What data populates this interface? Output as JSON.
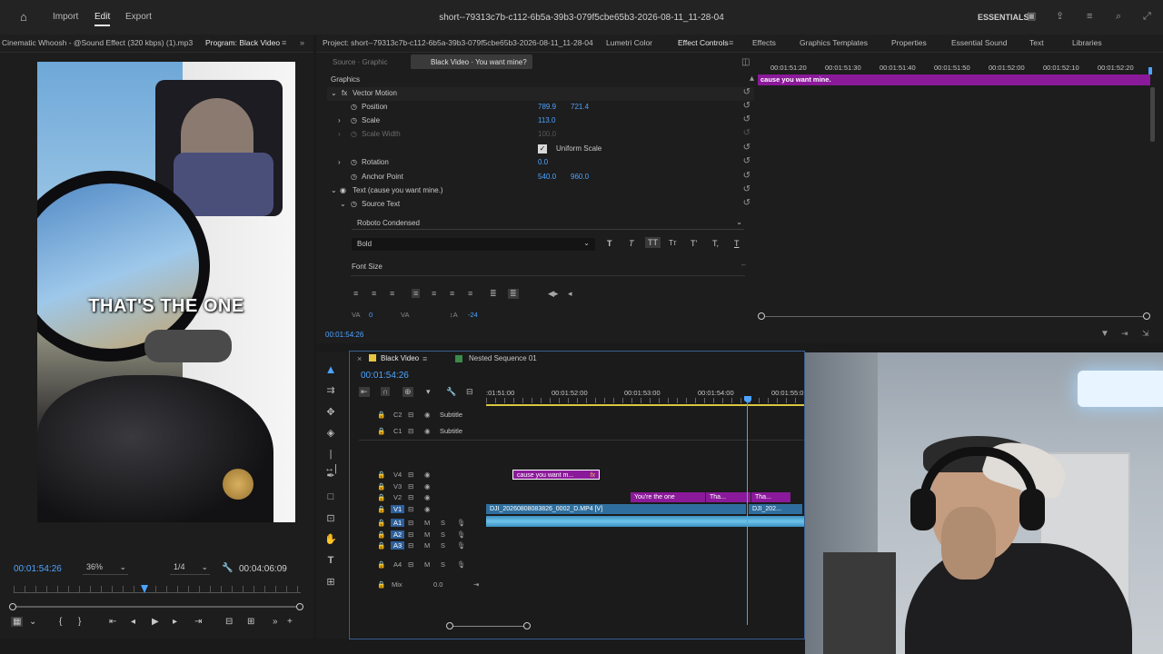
{
  "menu": {
    "import": "Import",
    "edit": "Edit",
    "export": "Export"
  },
  "project_title": "short--79313c7b-c112-6b5a-39b3-079f5cbe65b3-2026-08-11_11-28-04",
  "workspace": "ESSENTIALS",
  "panels": {
    "source_tab": "Cinematic Whoosh - @Sound Effect (320 kbps) (1).mp3",
    "program_tab": "Program: Black Video",
    "project_tab": "Project: short--79313c7b-c112-6b5a-39b3-079f5cbe65b3-2026-08-11_11-28-04",
    "lumetri": "Lumetri Color",
    "effect_controls": "Effect Controls",
    "effects": "Effects",
    "graphics_templates": "Graphics Templates",
    "properties": "Properties",
    "essential_sound": "Essential Sound",
    "text": "Text",
    "libraries": "Libraries"
  },
  "program": {
    "caption": "THAT'S THE ONE",
    "timecode": "00:01:54:26",
    "zoom": "36%",
    "resolution": "1/4",
    "duration": "00:04:06:09"
  },
  "effect_controls": {
    "source_graphic": "Source · Graphic",
    "clip_name": "Black Video · You want mine?",
    "section": "Graphics",
    "vector_motion": "Vector Motion",
    "position_label": "Position",
    "position_x": "789.9",
    "position_y": "721.4",
    "scale_label": "Scale",
    "scale_value": "113.0",
    "scale_width_label": "Scale Width",
    "scale_width_value": "100.0",
    "uniform_scale": "Uniform Scale",
    "rotation_label": "Rotation",
    "rotation_value": "0.0",
    "anchor_label": "Anchor Point",
    "anchor_x": "540.0",
    "anchor_y": "960.0",
    "text_layer": "Text (cause you want mine.)",
    "source_text": "Source Text",
    "font": "Roboto Condensed",
    "font_style": "Bold",
    "font_size_label": "Font Size",
    "tracking_value": "0",
    "kerning_value": "-24",
    "timecode": "00:01:54:26",
    "ruler": [
      "00:01:51:20",
      "00:01:51:30",
      "00:01:51:40",
      "00:01:51:50",
      "00:01:52:00",
      "00:01:52:10",
      "00:01:52:20"
    ],
    "graphic_clip": "cause you want mine."
  },
  "timeline": {
    "tab_active": "Black Video",
    "tab_other": "Nested Sequence 01",
    "timecode": "00:01:54:26",
    "ruler": [
      ":01:51:00",
      "00:01:52:00",
      "00:01:53:00",
      "00:01:54:00",
      "00:01:55:0"
    ],
    "tracks": {
      "c2": "C2",
      "c1": "C1",
      "subtitle1": "Subtitle",
      "subtitle2": "Subtitle",
      "v4": "V4",
      "v3": "V3",
      "v2": "V2",
      "v1": "V1",
      "a1": "A1",
      "a2": "A2",
      "a3": "A3",
      "a4": "A4",
      "mix": "Mix",
      "mix_value": "0.0"
    },
    "clips": {
      "graphic": "cause you want m...",
      "v2_a": "You're the one",
      "v2_b": "Tha...",
      "v2_c": "Tha...",
      "v1_a": "DJI_20260808083826_0002_D.MP4 [V]",
      "v1_b": "DJI_202..."
    }
  },
  "colors": {
    "accent": "#4da3ff",
    "graphic_clip": "#a020b0",
    "video_clip": "#3d8fbf",
    "audio_clip": "#5ab6e0"
  }
}
